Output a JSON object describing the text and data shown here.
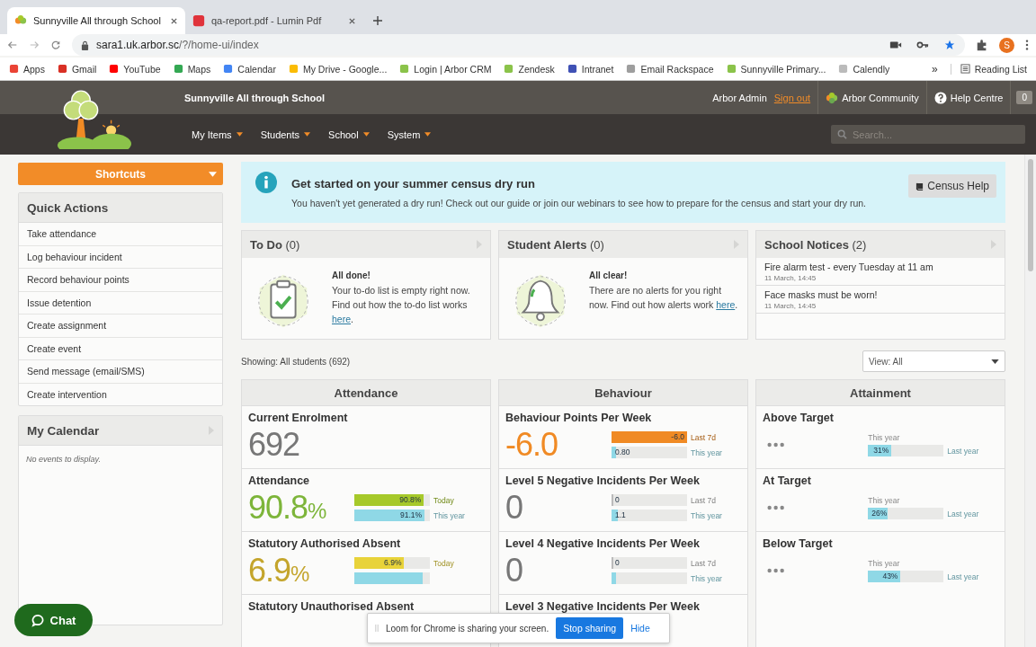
{
  "browser": {
    "tabs": [
      {
        "title": "Sunnyville All through School",
        "selected": true
      },
      {
        "title": "qa-report.pdf - Lumin Pdf",
        "selected": false
      }
    ],
    "url_host": "sara1.uk.arbor.sc",
    "url_path": "/?/home-ui/index",
    "avatar": "S",
    "bookmarks": [
      "Apps",
      "Gmail",
      "YouTube",
      "Maps",
      "Calendar",
      "My Drive - Google...",
      "Login | Arbor CRM",
      "Zendesk",
      "Intranet",
      "Email Rackspace",
      "Sunnyville Primary...",
      "Calendly"
    ],
    "more": "»",
    "reading_list": "Reading List"
  },
  "header": {
    "school": "Sunnyville All through School",
    "user": "Arbor Admin",
    "sign_out": "Sign out",
    "community": "Arbor Community",
    "help": "Help Centre",
    "notifications": "0",
    "nav": [
      "My Items",
      "Students",
      "School",
      "System"
    ],
    "search": {
      "placeholder": "Search..."
    }
  },
  "sidebar": {
    "shortcuts": "Shortcuts",
    "quick_actions": {
      "title": "Quick Actions",
      "items": [
        "Take attendance",
        "Log behaviour incident",
        "Record behaviour points",
        "Issue detention",
        "Create assignment",
        "Create event",
        "Send message (email/SMS)",
        "Create intervention"
      ]
    },
    "calendar": {
      "title": "My Calendar",
      "empty": "No events to display."
    }
  },
  "banner": {
    "title": "Get started on your summer census dry run",
    "text": "You haven't yet generated a dry run! Check out our guide or join our webinars to see how to prepare for the census and start your dry run.",
    "button": "Census Help"
  },
  "cards": [
    {
      "kind": "todo",
      "title": "To Do",
      "count": "(0)",
      "heading": "All done!",
      "text": "Your to-do list is empty right now. Find out how the to-do list works ",
      "link": "here",
      "after": "."
    },
    {
      "kind": "alerts",
      "title": "Student Alerts",
      "count": "(0)",
      "heading": "All clear!",
      "text": "There are no alerts for you right now. Find out how alerts work ",
      "link": "here",
      "after": "."
    },
    {
      "kind": "notices",
      "title": "School Notices",
      "count": "(2)",
      "notices": [
        {
          "title": "Fire alarm test - every Tuesday at 11 am",
          "time": "11 March, 14:45"
        },
        {
          "title": "Face masks must be worn!",
          "time": "11 March, 14:45"
        }
      ]
    }
  ],
  "showing": "Showing: All students (692)",
  "view": "View: All",
  "tiles": [
    {
      "title": "Attendance",
      "metrics": [
        {
          "kind": "stat",
          "title": "Current Enrolment",
          "value": "692",
          "color": "#777777"
        },
        {
          "kind": "stat",
          "title": "Attendance",
          "value": "90.8",
          "unit": "%",
          "color": "#7db53a",
          "bars": [
            {
              "value": "90.8%",
              "level": 0.92,
              "color": "#a6c92a",
              "label": "Today"
            },
            {
              "value": "91.1%",
              "level": 0.93,
              "color": "#8fd8e6",
              "label": "This year"
            }
          ]
        },
        {
          "kind": "stat",
          "title": "Statutory Authorised Absent",
          "value": "6.9",
          "unit": "%",
          "color": "#c4a52c",
          "bars": [
            {
              "value": "6.9%",
              "level": 0.66,
              "color": "#e8d33a",
              "label": "Today"
            },
            {
              "level": 0.9,
              "color": "#8fd8e6"
            }
          ]
        },
        {
          "kind": "stat",
          "title": "Statutory Unauthorised Absent"
        }
      ]
    },
    {
      "title": "Behaviour",
      "metrics": [
        {
          "kind": "stat",
          "title": "Behaviour Points Per Week",
          "value": "-6.0",
          "color": "#f08a24",
          "bars": [
            {
              "value": "-6.0",
              "level": 1,
              "color": "#f08a24",
              "label": "Last 7d"
            },
            {
              "value": "0.80",
              "level": 0.06,
              "color": "#8fd8e6",
              "label": "This year"
            }
          ]
        },
        {
          "kind": "stat",
          "title": "Level 5 Negative Incidents Per Week",
          "value": "0",
          "color": "#777777",
          "bars": [
            {
              "value": "0",
              "level": 0,
              "color": "#bbbbbb",
              "label": "Last 7d"
            },
            {
              "value": "1.1",
              "level": 0.08,
              "color": "#8fd8e6",
              "label": "This year"
            }
          ]
        },
        {
          "kind": "stat",
          "title": "Level 4 Negative Incidents Per Week",
          "value": "0",
          "color": "#777777",
          "bars": [
            {
              "value": "0",
              "level": 0,
              "color": "#bbbbbb",
              "label": "Last 7d"
            },
            {
              "level": 0.06,
              "color": "#8fd8e6",
              "label": "This year"
            }
          ]
        },
        {
          "kind": "stat",
          "title": "Level 3 Negative Incidents Per Week"
        }
      ]
    },
    {
      "title": "Attainment",
      "metrics": [
        {
          "kind": "attainment",
          "title": "Above Target",
          "caption": "This year",
          "bar": {
            "value": "31%",
            "level": 0.31,
            "color": "#8fd8e6",
            "label": "Last year"
          }
        },
        {
          "kind": "attainment",
          "title": "At Target",
          "caption": "This year",
          "bar": {
            "value": "26%",
            "level": 0.26,
            "color": "#8fd8e6",
            "label": "Last year"
          }
        },
        {
          "kind": "attainment",
          "title": "Below Target",
          "caption": "This year",
          "bar": {
            "value": "43%",
            "level": 0.43,
            "color": "#8fd8e6",
            "label": "Last year"
          }
        }
      ]
    }
  ],
  "chat": "Chat",
  "loom": {
    "text": "Loom for Chrome is sharing your screen.",
    "stop": "Stop sharing",
    "hide": "Hide"
  }
}
